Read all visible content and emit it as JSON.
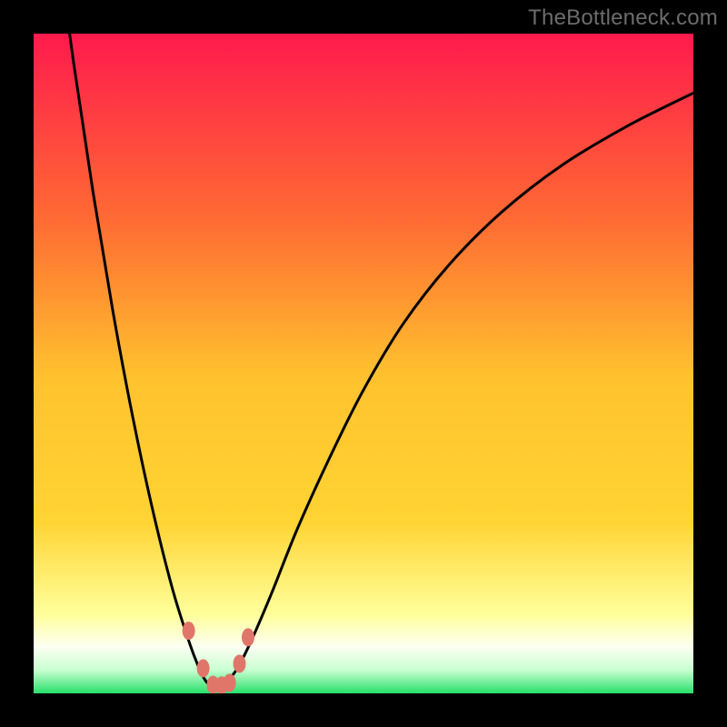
{
  "watermark": "TheBottleneck.com",
  "colors": {
    "frame_bg": "#000000",
    "curve": "#000000",
    "points": "#e0766a",
    "gradient_top": "#ff1a4d",
    "gradient_mid_upper": "#ff8a2a",
    "gradient_mid": "#ffd433",
    "gradient_mid_lower": "#ffff7a",
    "gradient_band_pale": "#fafffb",
    "gradient_bottom": "#27e06a"
  },
  "chart_data": {
    "type": "line",
    "title": "",
    "xlabel": "",
    "ylabel": "",
    "xlim": [
      0,
      100
    ],
    "ylim": [
      0,
      100
    ],
    "grid": false,
    "legend": false,
    "series": [
      {
        "name": "bottleneck-curve",
        "x": [
          0,
          3,
          6,
          9,
          12,
          15,
          18,
          21,
          23.5,
          25,
          26,
          27,
          28,
          29.5,
          31,
          33,
          36,
          40,
          45,
          50,
          56,
          63,
          71,
          80,
          90,
          100
        ],
        "y": [
          140,
          118,
          96,
          76,
          58,
          42,
          28,
          16,
          8,
          4,
          2,
          1,
          1,
          2,
          4,
          8,
          15,
          25,
          36,
          46,
          56,
          65,
          73,
          80,
          86,
          91
        ]
      }
    ],
    "points": {
      "name": "highlight-points",
      "x": [
        23.5,
        25.7,
        27.2,
        28.5,
        29.7,
        31.2,
        32.5
      ],
      "y": [
        9.5,
        3.8,
        1.3,
        1.2,
        1.6,
        4.5,
        8.5
      ]
    }
  }
}
